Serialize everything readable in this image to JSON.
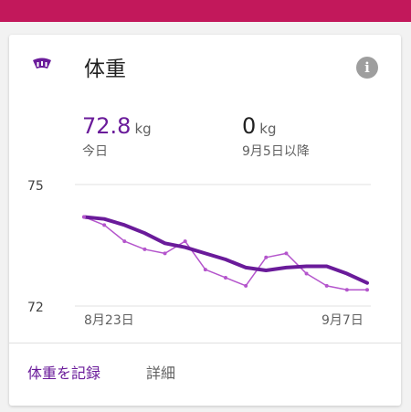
{
  "colors": {
    "header_bar": "#c2185b",
    "accent": "#6a1b9a",
    "trend_line": "#6a1b9a",
    "daily_line": "#b455cc"
  },
  "card": {
    "title": "体重",
    "icon": "scale-icon",
    "info_icon": "info-icon",
    "info_glyph": "i"
  },
  "stats": [
    {
      "value": "72.8",
      "unit": "kg",
      "label": "今日"
    },
    {
      "value": "0",
      "unit": "kg",
      "label": "9月5日以降"
    }
  ],
  "actions": {
    "record": "体重を記録",
    "details": "詳細"
  },
  "chart_data": {
    "type": "line",
    "ylim": [
      72,
      75
    ],
    "y_ticks": [
      "75",
      "72"
    ],
    "x_tick_labels": [
      "8月23日",
      "9月7日"
    ],
    "grid": true,
    "series": [
      {
        "role": "daily",
        "x": [
          0,
          1,
          2,
          3,
          4,
          5,
          6,
          7,
          8,
          9,
          10,
          11,
          12,
          13,
          14
        ],
        "values": [
          74.2,
          74.0,
          73.6,
          73.4,
          73.3,
          73.6,
          72.9,
          72.7,
          72.5,
          73.2,
          73.3,
          72.8,
          72.5,
          72.4,
          72.4
        ]
      },
      {
        "role": "trend",
        "x": [
          0,
          1,
          2,
          3,
          4,
          5,
          6,
          7,
          8,
          9,
          10,
          11,
          12,
          13,
          14
        ],
        "values": [
          74.2,
          74.15,
          74.0,
          73.8,
          73.55,
          73.45,
          73.3,
          73.15,
          72.95,
          72.88,
          72.95,
          72.98,
          72.98,
          72.8,
          72.57
        ]
      }
    ]
  }
}
